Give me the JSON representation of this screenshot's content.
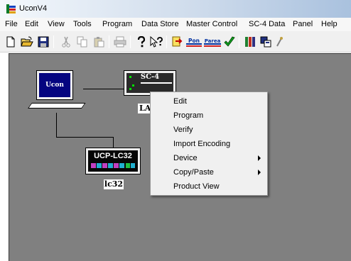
{
  "window": {
    "title": "UconV4"
  },
  "menubar": {
    "items": [
      "File",
      "Edit",
      "View",
      "Tools",
      "Program",
      "Data Store",
      "Master Control",
      "SC-4 Data",
      "Panel",
      "Help"
    ]
  },
  "toolbar": {
    "pon_label": "Pon",
    "parea_label": "Parea"
  },
  "devices": {
    "laptop": {
      "screen_label": "Ucon"
    },
    "sc4": {
      "title": "SC-4",
      "name": "LA"
    },
    "lc32": {
      "title": "UCP-LC32",
      "name": "lc32"
    }
  },
  "context_menu": {
    "items": [
      {
        "label": "Edit"
      },
      {
        "label": "Program"
      },
      {
        "label": "Verify"
      },
      {
        "label": "Import Encoding"
      },
      {
        "label": "Device"
      },
      {
        "label": "Copy/Paste"
      },
      {
        "label": "Product View"
      }
    ]
  },
  "colors": {
    "canvas": "#808080",
    "laptop_screen": "#050580",
    "led_green": "#00e000"
  }
}
